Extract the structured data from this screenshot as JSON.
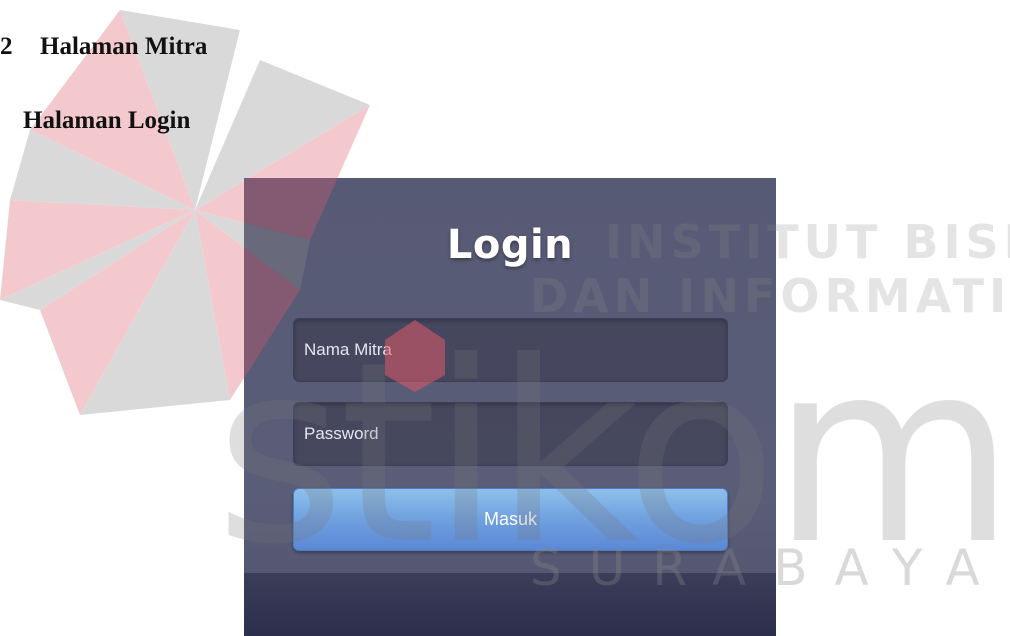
{
  "document": {
    "section_number": "2",
    "section_title": "Halaman Mitra",
    "subsection_title": "Halaman Login"
  },
  "login_form": {
    "title": "Login",
    "username_placeholder": "Nama Mitra",
    "password_placeholder": "Password",
    "submit_label": "Masuk"
  },
  "watermark": {
    "line1": "INSTITUT BISNIS",
    "line2": "DAN INFORMATIKA",
    "logo_word": "stikom",
    "city": "SURABAYA",
    "colors": {
      "red": "#e05a6a",
      "gray": "#8a8a8a"
    }
  }
}
